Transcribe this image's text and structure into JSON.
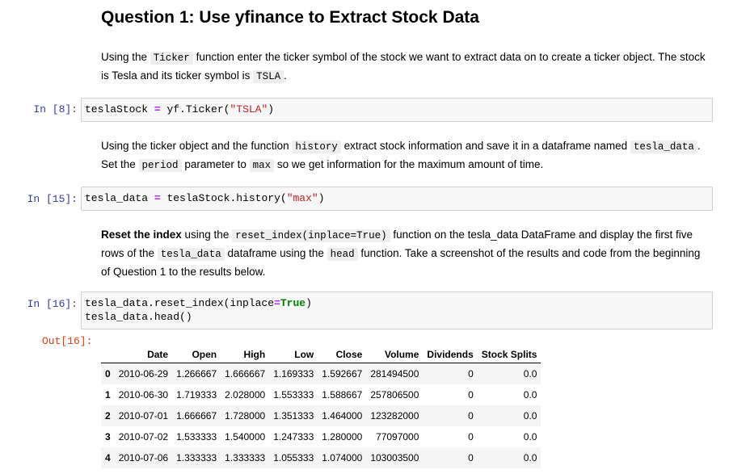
{
  "heading": "Question 1: Use yfinance to Extract Stock Data",
  "md1": {
    "t1": "Using the ",
    "c1": "Ticker",
    "t2": " function enter the ticker symbol of the stock we want to extract data on to create a ticker object. The stock is Tesla and its ticker symbol is ",
    "c2": "TSLA",
    "t3": "."
  },
  "cell8": {
    "prompt": "In [8]:",
    "var": "teslaStock",
    "op": "=",
    "call": "yf.Ticker(",
    "arg": "\"TSLA\"",
    "close": ")"
  },
  "md2": {
    "t1": "Using the ticker object and the function ",
    "c1": "history",
    "t2": " extract stock information and save it in a dataframe named ",
    "c2": "tesla_data",
    "t3": ". Set the ",
    "c3": "period",
    "t4": " parameter to ",
    "c4": "max",
    "t5": " so we get information for the maximum amount of time."
  },
  "cell15": {
    "prompt": "In [15]:",
    "var": "tesla_data",
    "op": "=",
    "call": "teslaStock.history(",
    "arg": "\"max\"",
    "close": ")"
  },
  "md3": {
    "b1": "Reset the index",
    "t1": " using the ",
    "c1": "reset_index(inplace=True)",
    "t2": " function on the tesla_data DataFrame and display the first five rows of the ",
    "c2": "tesla_data",
    "t3": " dataframe using the ",
    "c3": "head",
    "t4": " function. Take a screenshot of the results and code from the beginning of Question 1 to the results below."
  },
  "cell16": {
    "prompt": "In [16]:",
    "l1a": "tesla_data.reset_index(inplace",
    "l1op": "=",
    "l1kw": "True",
    "l1close": ")",
    "l2": "tesla_data.head()",
    "out_prompt": "Out[16]:"
  },
  "table": {
    "columns": [
      "",
      "Date",
      "Open",
      "High",
      "Low",
      "Close",
      "Volume",
      "Dividends",
      "Stock Splits"
    ],
    "rows": [
      [
        "0",
        "2010-06-29",
        "1.266667",
        "1.666667",
        "1.169333",
        "1.592667",
        "281494500",
        "0",
        "0.0"
      ],
      [
        "1",
        "2010-06-30",
        "1.719333",
        "2.028000",
        "1.553333",
        "1.588667",
        "257806500",
        "0",
        "0.0"
      ],
      [
        "2",
        "2010-07-01",
        "1.666667",
        "1.728000",
        "1.351333",
        "1.464000",
        "123282000",
        "0",
        "0.0"
      ],
      [
        "3",
        "2010-07-02",
        "1.533333",
        "1.540000",
        "1.247333",
        "1.280000",
        "77097000",
        "0",
        "0.0"
      ],
      [
        "4",
        "2010-07-06",
        "1.333333",
        "1.333333",
        "1.055333",
        "1.074000",
        "103003500",
        "0",
        "0.0"
      ]
    ]
  }
}
